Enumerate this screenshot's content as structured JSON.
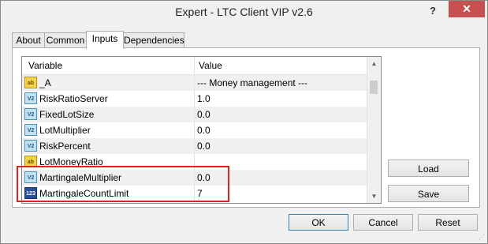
{
  "window": {
    "title": "Expert - LTC Client VIP v2.6",
    "help_label": "?",
    "close_label": "✕"
  },
  "tabs": [
    {
      "label": "About"
    },
    {
      "label": "Common"
    },
    {
      "label": "Inputs"
    },
    {
      "label": "Dependencies"
    }
  ],
  "table": {
    "columns": {
      "variable": "Variable",
      "value": "Value"
    },
    "rows": [
      {
        "icon": "ab",
        "icon_label": "ab",
        "variable": "_A",
        "value": "--- Money management ---"
      },
      {
        "icon": "v2",
        "icon_label": "V2",
        "variable": "RiskRatioServer",
        "value": "1.0"
      },
      {
        "icon": "v2",
        "icon_label": "V2",
        "variable": "FixedLotSize",
        "value": "0.0"
      },
      {
        "icon": "v2",
        "icon_label": "V2",
        "variable": "LotMultiplier",
        "value": "0.0"
      },
      {
        "icon": "v2",
        "icon_label": "V2",
        "variable": "RiskPercent",
        "value": "0.0"
      },
      {
        "icon": "ab",
        "icon_label": "ab",
        "variable": "LotMoneyRatio",
        "value": ""
      },
      {
        "icon": "v2",
        "icon_label": "V2",
        "variable": "MartingaleMultiplier",
        "value": "0.0"
      },
      {
        "icon": "n123",
        "icon_label": "123",
        "variable": "MartingaleCountLimit",
        "value": "7"
      }
    ]
  },
  "side_buttons": {
    "load": "Load",
    "save": "Save"
  },
  "footer_buttons": {
    "ok": "OK",
    "cancel": "Cancel",
    "reset": "Reset"
  },
  "colors": {
    "highlight": "#e0231d",
    "titlebar_close": "#c75050"
  }
}
